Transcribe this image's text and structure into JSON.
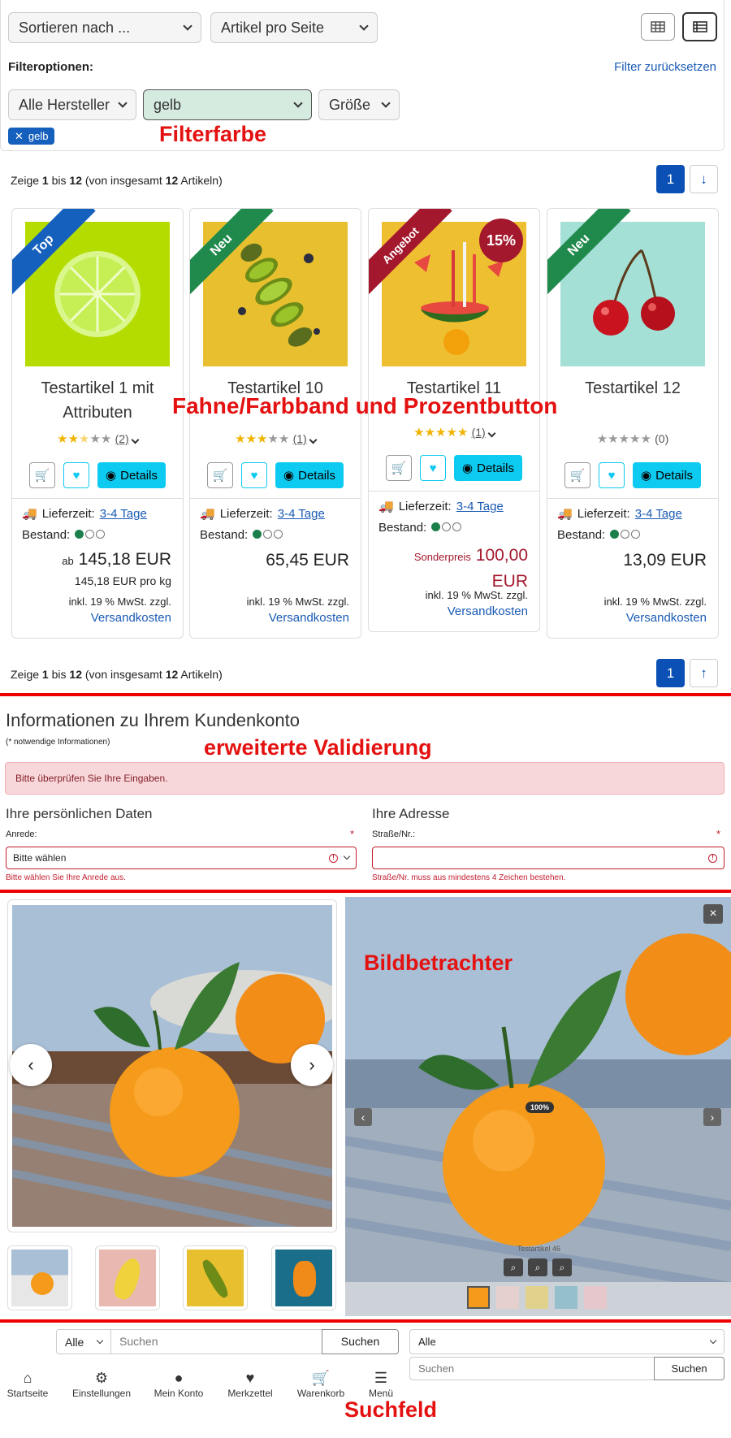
{
  "toolbar": {
    "sort_label": "Sortieren nach ...",
    "per_page_label": "Artikel pro Seite",
    "filter_options_label": "Filteroptionen:",
    "reset_filter": "Filter zurücksetzen",
    "manufacturer_filter": "Alle Hersteller",
    "color_filter_value": "gelb",
    "size_filter": "Größe",
    "active_filter_chip": "gelb",
    "view_grid_icon": "grid-icon",
    "view_list_icon": "list-icon"
  },
  "annotations": {
    "filter_color": "Filterfarbe",
    "ribbon_percent": "Fahne/Farbband und Prozentbutton",
    "validation": "erweiterte Validierung",
    "image_viewer": "Bildbetrachter",
    "search_field": "Suchfeld"
  },
  "pagination": {
    "text_prefix": "Zeige ",
    "from": "1",
    "to_text": " bis ",
    "to": "12",
    "total_prefix": " (von insgesamt ",
    "total": "12",
    "total_suffix": " Artikeln)",
    "current_page": "1"
  },
  "products": [
    {
      "name_line1": "Testartikel 1 mit",
      "name_line2": "Attributen",
      "ribbon": "Top",
      "ribbon_color": "#1560bd",
      "rating": 2.5,
      "rating_count": "(2)",
      "delivery_label": "Lieferzeit:",
      "delivery_value": "3-4 Tage",
      "stock_label": "Bestand:",
      "price_prefix": "ab",
      "price": "145,18 EUR",
      "unit_price": "145,18 EUR pro kg",
      "tax": "inkl. 19 % MwSt. zzgl.",
      "shipping": "Versandkosten",
      "details": "Details"
    },
    {
      "name_line1": "Testartikel 10",
      "name_line2": "",
      "ribbon": "Neu",
      "ribbon_color": "#1f8a4c",
      "rating": 3,
      "rating_count": "(1)",
      "delivery_label": "Lieferzeit:",
      "delivery_value": "3-4 Tage",
      "stock_label": "Bestand:",
      "price": "65,45 EUR",
      "tax": "inkl. 19 % MwSt. zzgl.",
      "shipping": "Versandkosten",
      "details": "Details"
    },
    {
      "name_line1": "Testartikel 11",
      "name_line2": "",
      "ribbon": "Angebot",
      "ribbon_color": "#a3182c",
      "discount_badge": "15%",
      "rating": 5,
      "rating_count": "(1)",
      "delivery_label": "Lieferzeit:",
      "delivery_value": "3-4 Tage",
      "stock_label": "Bestand:",
      "special_label": "Sonderpreis",
      "price_line1": "100,00",
      "price_line2": "EUR",
      "tax": "inkl. 19 % MwSt. zzgl.",
      "shipping": "Versandkosten",
      "details": "Details"
    },
    {
      "name_line1": "Testartikel 12",
      "name_line2": "",
      "ribbon": "Neu",
      "ribbon_color": "#1f8a4c",
      "rating": 0,
      "rating_count": "(0)",
      "delivery_label": "Lieferzeit:",
      "delivery_value": "3-4 Tage",
      "stock_label": "Bestand:",
      "price": "13,09 EUR",
      "tax": "inkl. 19 % MwSt. zzgl.",
      "shipping": "Versandkosten",
      "details": "Details"
    }
  ],
  "account": {
    "title": "Informationen zu Ihrem Kundenkonto",
    "required_note": "(* notwendige Informationen)",
    "alert": "Bitte überprüfen Sie Ihre Eingaben.",
    "personal_heading": "Ihre persönlichen Daten",
    "address_heading": "Ihre Adresse",
    "salutation_label": "Anrede:",
    "salutation_value": "Bitte wählen",
    "salutation_error": "Bitte wählen Sie Ihre Anrede aus.",
    "street_label": "Straße/Nr.:",
    "street_error": "Straße/Nr. muss aus mindestens 4 Zeichen bestehen.",
    "required_mark": "*"
  },
  "viewer": {
    "zoom": "100%",
    "caption": "Testartikel 46",
    "close": "×"
  },
  "search": {
    "scope": "Alle",
    "placeholder": "Suchen",
    "button": "Suchen",
    "scope2": "Alle",
    "placeholder2": "Suchen",
    "button2": "Suchen"
  },
  "bottom_nav": [
    {
      "label": "Startseite",
      "icon": "home-icon"
    },
    {
      "label": "Einstellungen",
      "icon": "gear-icon"
    },
    {
      "label": "Mein Konto",
      "icon": "user-icon"
    },
    {
      "label": "Merkzettel",
      "icon": "heart-icon"
    },
    {
      "label": "Warenkorb",
      "icon": "cart-icon"
    },
    {
      "label": "Menü",
      "icon": "menu-icon"
    }
  ],
  "colors": {
    "accent": "#0d6efd",
    "details_button": "#0dcaf0",
    "error": "#c21d2e",
    "annotation": "#e41111",
    "selected_filter_bg": "#d5ebe0"
  }
}
